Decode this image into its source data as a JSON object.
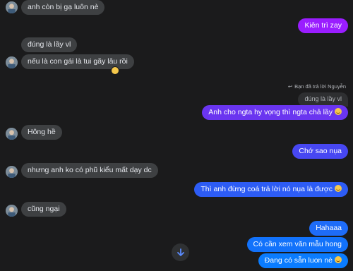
{
  "messages": {
    "m1": "anh còn bị gạ luôn nè",
    "m2": "Kiên trì zay",
    "m3": "đúng là lầy vl",
    "m4": "nếu là con gái là tui gãy lâu rồi",
    "reply_note": "Bạn đã trả lời Nguyễn",
    "quoted": "đúng là lầy vl",
    "m5": "Anh cho ngta hy vọng thì ngta chả lầy",
    "m6": "Hông hề",
    "m7": "Chớ sao nụa",
    "m8": "nhưng anh ko có phũ kiểu mất dạy dc",
    "m9": "Thì anh đừng coá trả lời nó nụa là được",
    "m10": "cũng ngại",
    "m11": "Hahaaa",
    "m12": "Có cần xem văn mẫu hong",
    "m13": "Đang có sẵn luon nè"
  },
  "colors": {
    "incoming_bubble": "#3e4042",
    "outgoing_purple": "#9a1dff",
    "outgoing_blue": "#0a7cff",
    "background": "#1b1b1c"
  },
  "icons": {
    "avatar": "avatar-icon",
    "reply": "reply-arrow-icon",
    "scroll": "arrow-down-icon",
    "emoji": "emoji-icon"
  }
}
